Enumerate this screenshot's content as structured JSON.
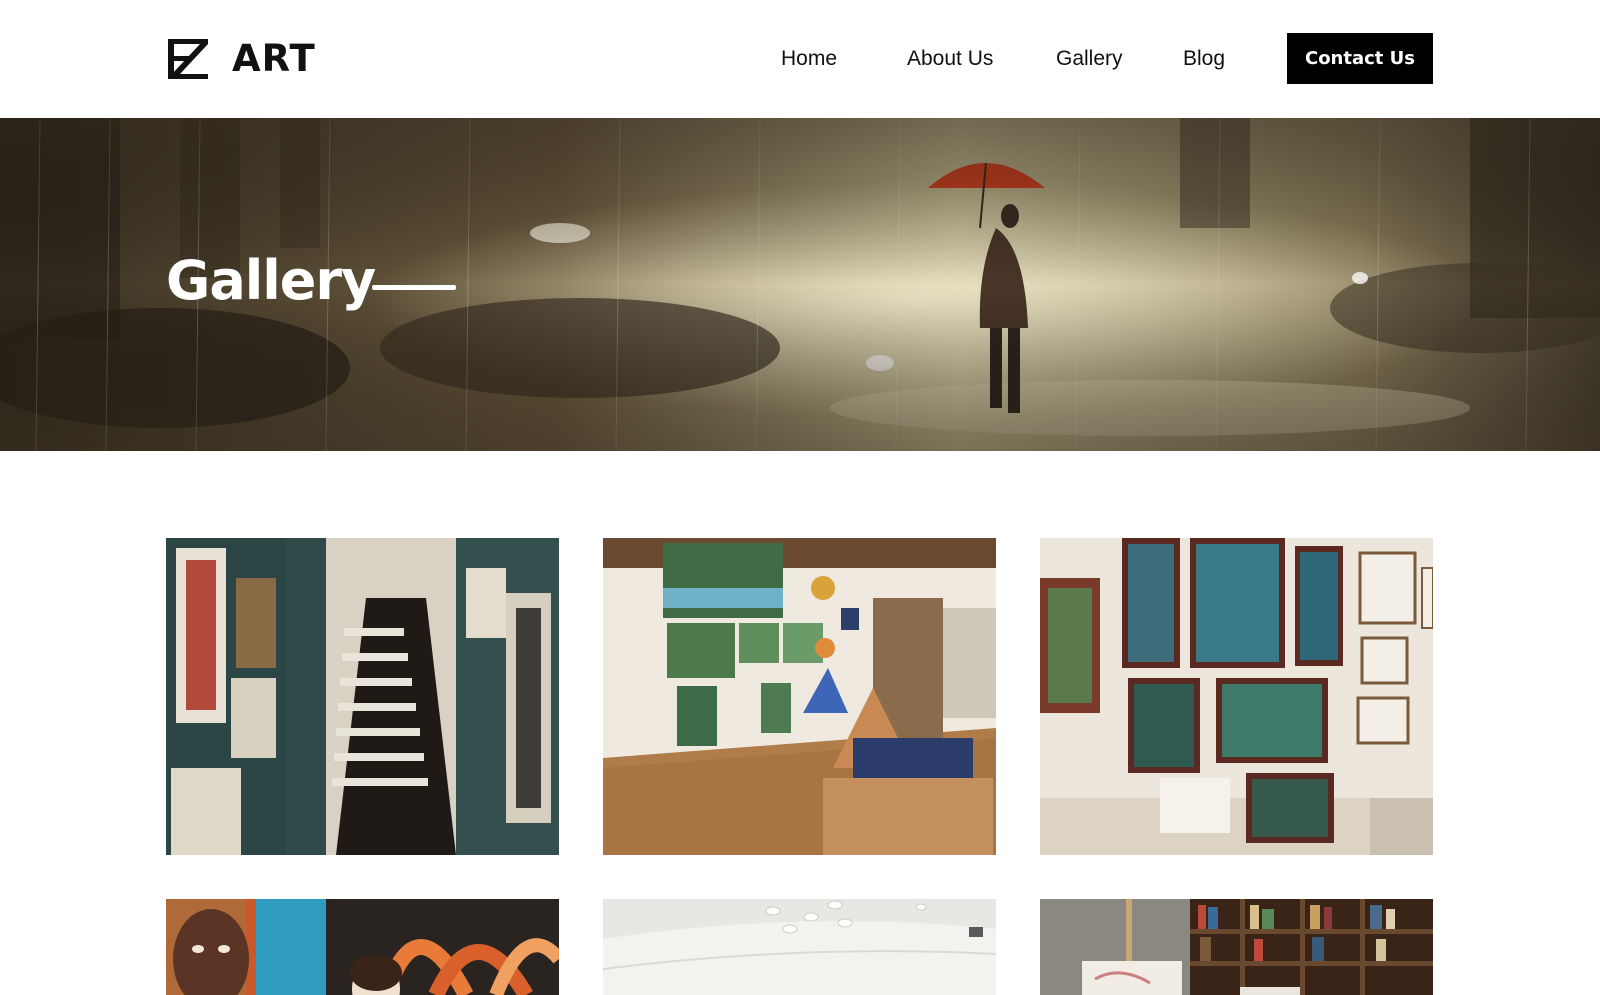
{
  "brand": {
    "name": "ART",
    "logo_icon": "ez-monogram-icon"
  },
  "nav": {
    "items": [
      {
        "label": "Home"
      },
      {
        "label": "About Us"
      },
      {
        "label": "Gallery"
      },
      {
        "label": "Blog"
      }
    ],
    "cta_label": "Contact Us"
  },
  "hero": {
    "title": "Gallery"
  },
  "gallery": {
    "images": [
      {
        "subject": "staircase-gallery-image"
      },
      {
        "subject": "landscape-exhibit-image"
      },
      {
        "subject": "tree-paintings-wall-image"
      },
      {
        "subject": "portrait-mural-image"
      },
      {
        "subject": "white-gallery-ceiling-image"
      },
      {
        "subject": "bookshelf-easel-image"
      }
    ]
  },
  "colors": {
    "header_bg": "#ffffff",
    "cta_bg": "#000000",
    "cta_text": "#ffffff",
    "hero_tone": "#8a7a55",
    "umbrella": "#d9401e"
  }
}
